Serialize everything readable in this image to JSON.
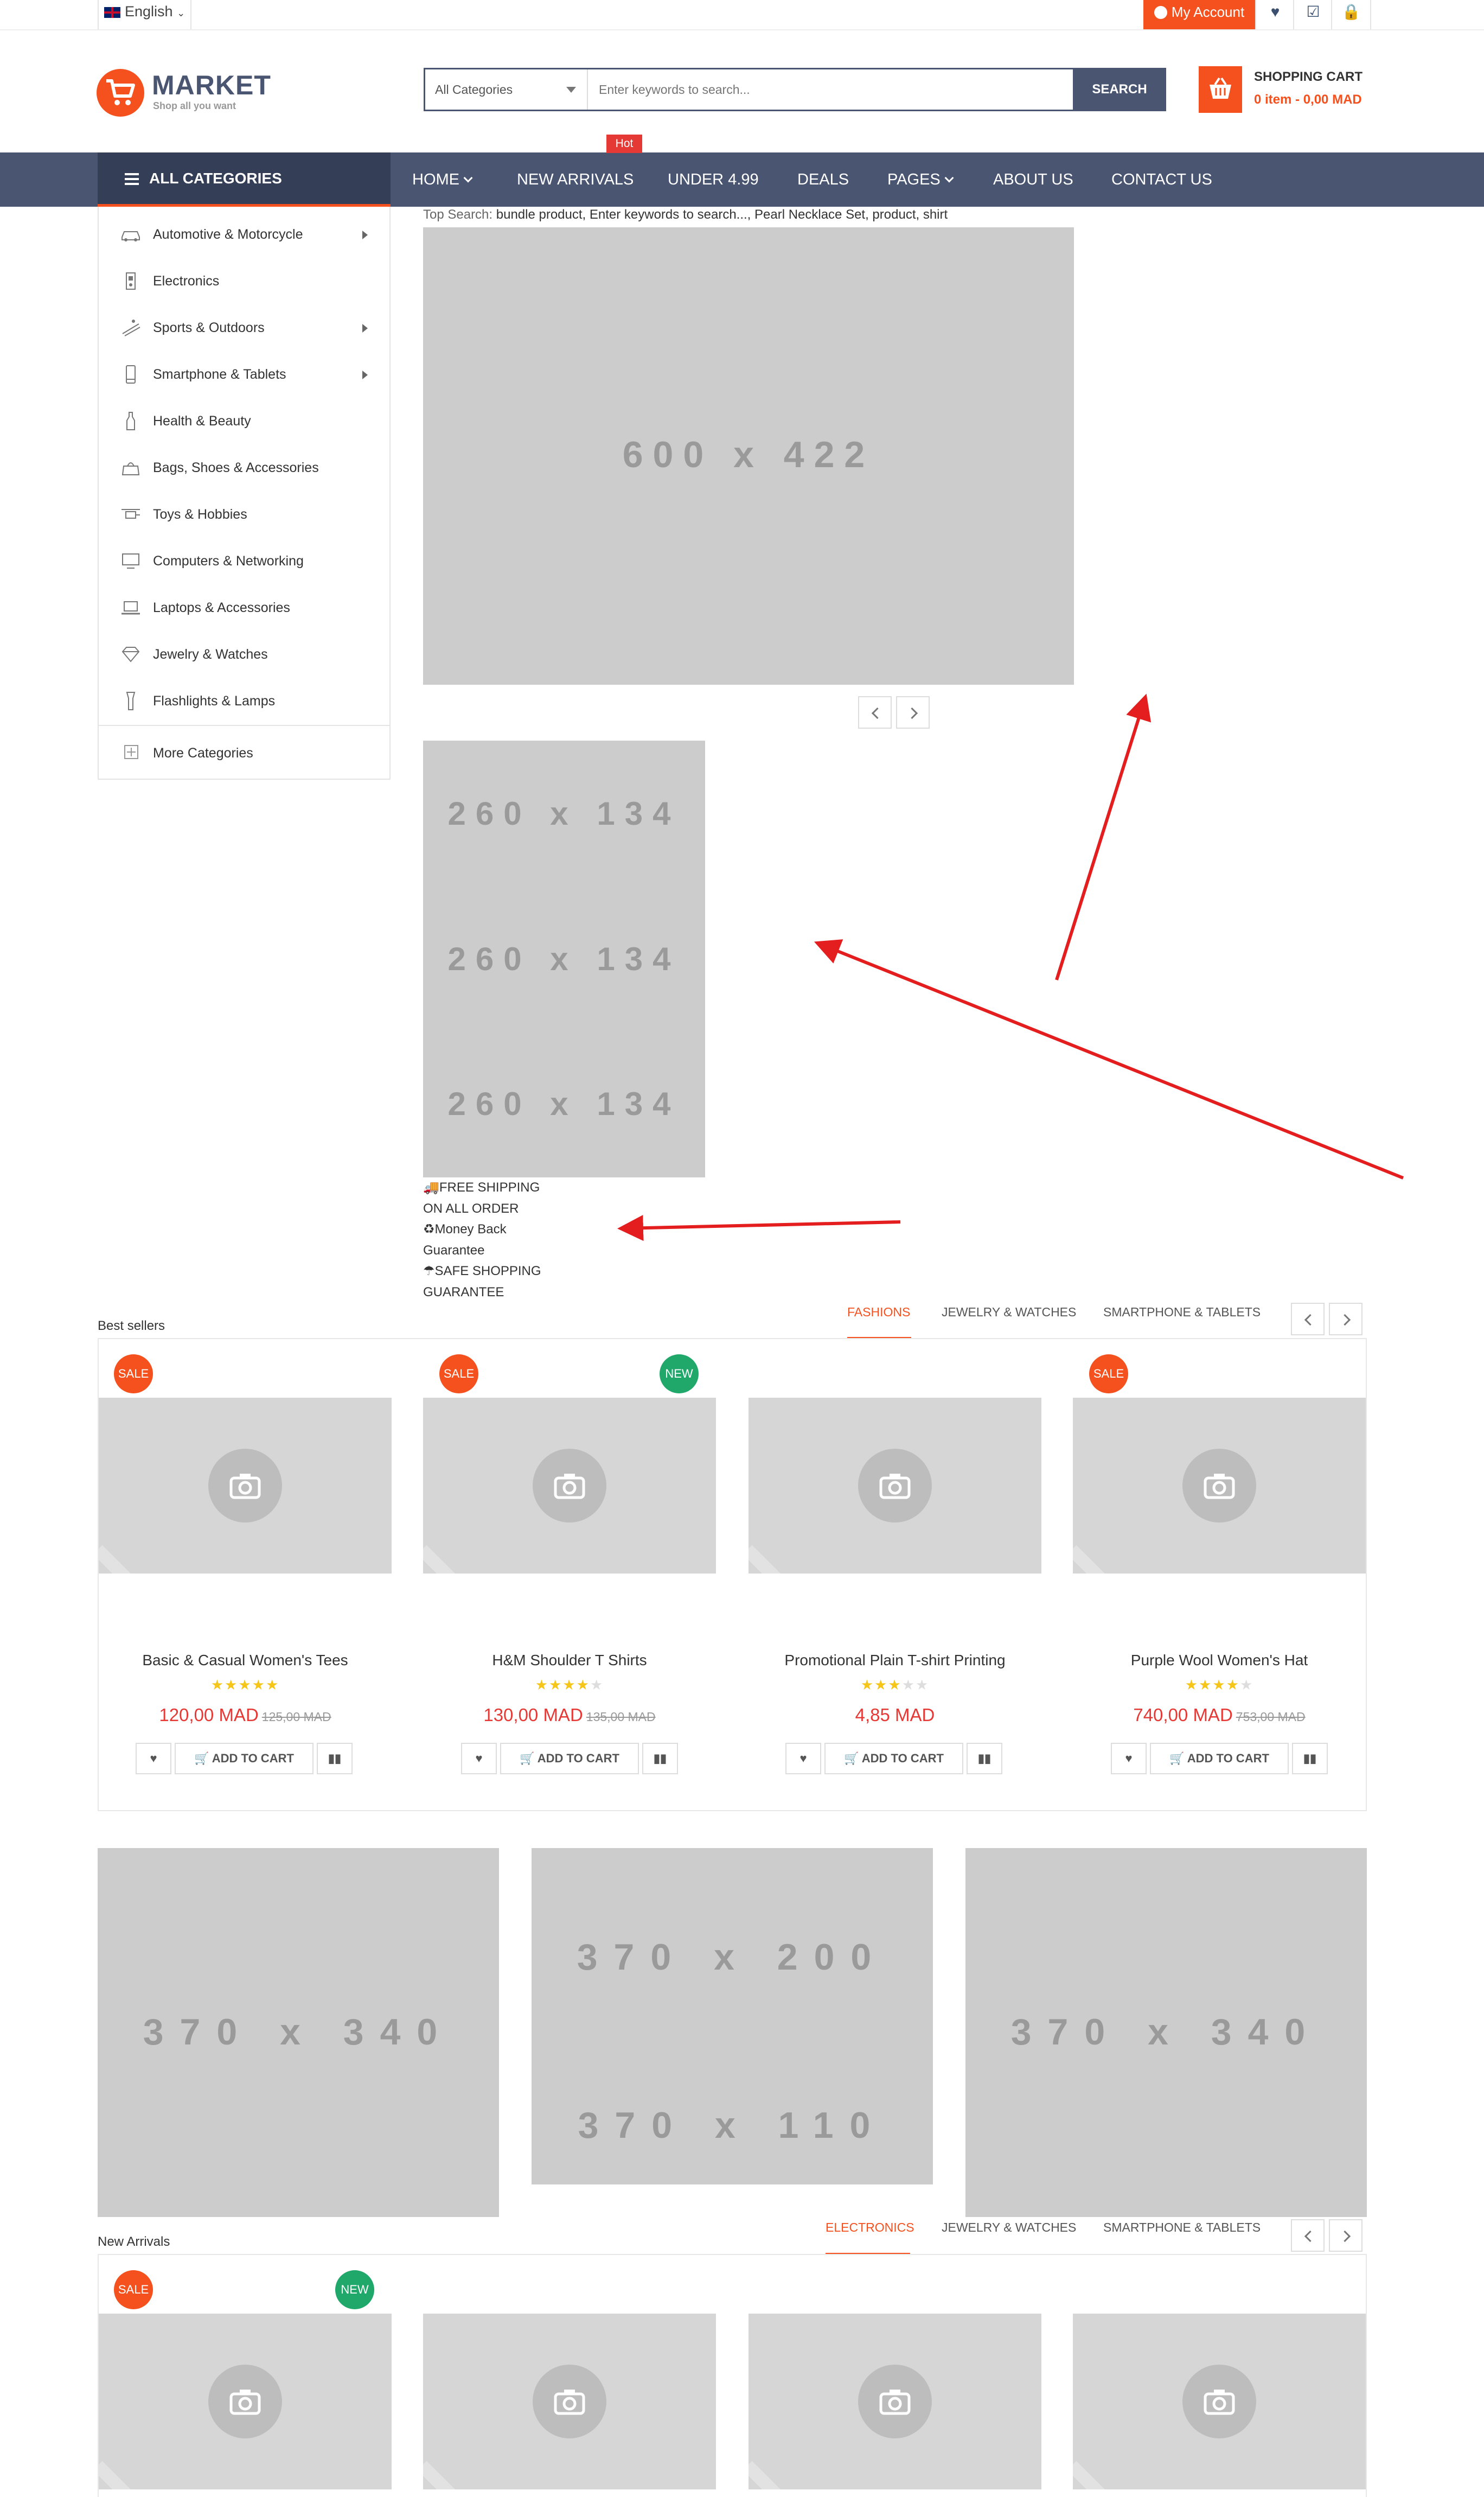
{
  "topbar": {
    "language": "English",
    "my_account": "My Account",
    "icons": [
      "heart-icon",
      "checkbox-icon",
      "lock-icon"
    ]
  },
  "header": {
    "logo_title": "MARKET",
    "logo_tagline": "Shop all you want",
    "search": {
      "category": "All Categories",
      "placeholder": "Enter keywords to search...",
      "button": "SEARCH"
    },
    "cart": {
      "title": "SHOPPING CART",
      "summary": "0 item - 0,00 MAD"
    }
  },
  "nav": {
    "all_categories": "ALL CATEGORIES",
    "items": [
      "HOME",
      "NEW ARRIVALS",
      "UNDER 4.99",
      "DEALS",
      "PAGES",
      "ABOUT US",
      "CONTACT US"
    ],
    "hot_badge": "Hot"
  },
  "top_search": {
    "label": "Top Search:",
    "terms": "bundle product,  Enter keywords to search...,  Pearl Necklace Set,  product,  shirt"
  },
  "sidebar": {
    "categories": [
      "Automotive & Motorcycle",
      "Electronics",
      "Sports & Outdoors",
      "Smartphone & Tablets",
      "Health & Beauty",
      "Bags, Shoes & Accessories",
      "Toys & Hobbies",
      "Computers & Networking",
      "Laptops & Accessories",
      "Jewelry & Watches",
      "Flashlights & Lamps"
    ],
    "more": "More Categories"
  },
  "slider": {
    "placeholder": "600 x 422"
  },
  "mid_banners": {
    "placeholders": [
      "260 x 134",
      "260 x 134",
      "260 x 134"
    ]
  },
  "shipping": {
    "lines": [
      "🚚FREE SHIPPING",
      "ON ALL ORDER",
      "♻Money Back",
      "Guarantee",
      "☂SAFE SHOPPING",
      "GUARANTEE"
    ]
  },
  "best_sellers": {
    "title": "Best sellers",
    "tabs": [
      "FASHIONS",
      "JEWELRY & WATCHES",
      "SMARTPHONE & TABLETS"
    ],
    "products": [
      {
        "name": "Basic & Casual Women's Tees",
        "price": "120,00 MAD",
        "old_price": "125,00 MAD",
        "rating": 5,
        "sale": "SALE",
        "new": ""
      },
      {
        "name": "H&M Shoulder T Shirts",
        "price": "130,00 MAD",
        "old_price": "135,00 MAD",
        "rating": 4.5,
        "sale": "SALE",
        "new": "NEW"
      },
      {
        "name": "Promotional Plain T-shirt Printing",
        "price": "4,85 MAD",
        "old_price": "",
        "rating": 3.5,
        "sale": "",
        "new": ""
      },
      {
        "name": "Purple Wool Women's Hat",
        "price": "740,00 MAD",
        "old_price": "753,00 MAD",
        "rating": 4.5,
        "sale": "SALE",
        "new": ""
      }
    ],
    "add_to_cart": "ADD TO CART"
  },
  "banners": {
    "left": "370 x 340",
    "center_top": "370 x 200",
    "center_bottom": "370 x 110",
    "right": "370 x 340"
  },
  "new_arrivals": {
    "title": "New Arrivals",
    "tabs": [
      "ELECTRONICS",
      "JEWELRY & WATCHES",
      "SMARTPHONE & TABLETS"
    ],
    "badges": {
      "sale": "SALE",
      "new": "NEW"
    }
  },
  "colors": {
    "accent": "#f4511e",
    "nav": "#4a5572",
    "price": "#e53935",
    "new_badge": "#20a86b",
    "annotation_arrow": "#e41e1e"
  }
}
